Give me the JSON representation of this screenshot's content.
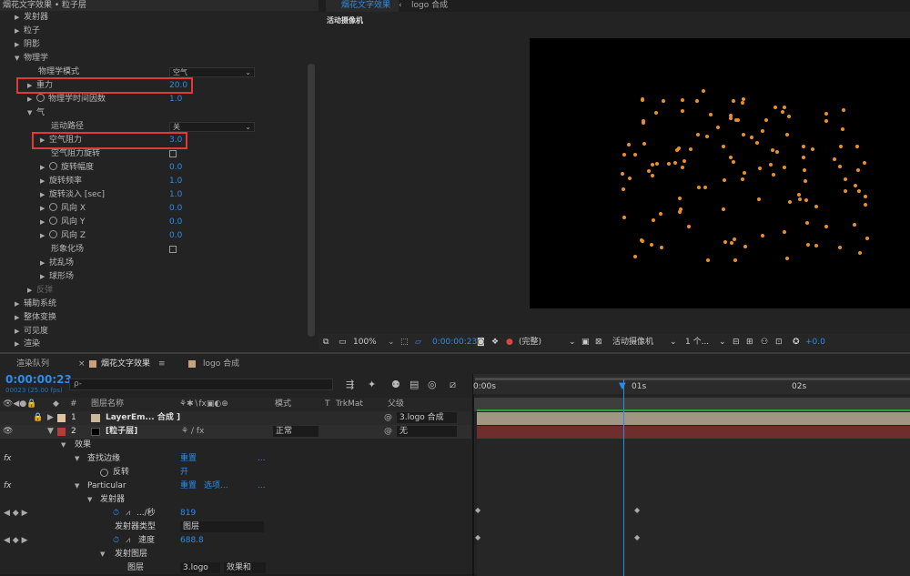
{
  "effect_panel": {
    "header": "烟花文字效果 • 粒子层",
    "rows": [
      {
        "label": "发射器",
        "value": ""
      },
      {
        "label": "粒子",
        "value": ""
      },
      {
        "label": "阴影",
        "value": ""
      },
      {
        "label": "物理学",
        "value": ""
      },
      {
        "label": "物理学模式",
        "value": "空气"
      },
      {
        "label": "重力",
        "value": "20.0"
      },
      {
        "label": "物理学时间因数",
        "value": "1.0"
      },
      {
        "label": "气",
        "value": ""
      },
      {
        "label": "运动路径",
        "value": "关"
      },
      {
        "label": "空气阻力",
        "value": "3.0"
      },
      {
        "label": "空气阻力旋转",
        "value": ""
      },
      {
        "label": "旋转幅度",
        "value": "0.0"
      },
      {
        "label": "旋转频率",
        "value": "1.0"
      },
      {
        "label": "旋转淡入 [sec]",
        "value": "1.0"
      },
      {
        "label": "风向 X",
        "value": "0.0"
      },
      {
        "label": "风向 Y",
        "value": "0.0"
      },
      {
        "label": "风向 Z",
        "value": "0.0"
      },
      {
        "label": "形象化场",
        "value": ""
      },
      {
        "label": "扰乱场",
        "value": ""
      },
      {
        "label": "球形场",
        "value": ""
      },
      {
        "label": "反弹",
        "value": ""
      },
      {
        "label": "辅助系统",
        "value": ""
      },
      {
        "label": "整体变换",
        "value": ""
      },
      {
        "label": "可见度",
        "value": ""
      },
      {
        "label": "渲染",
        "value": ""
      }
    ]
  },
  "viewer": {
    "tab_active": "烟花文字效果",
    "tab_other": "logo 合成",
    "camera_label": "活动摄像机",
    "zoom": "100%",
    "timecode": "0:00:00:23",
    "quality": "(完整)",
    "camera_dropdown": "活动摄像机",
    "views": "1 个...",
    "exposure": "+0.0"
  },
  "timeline": {
    "tab_render": "渲染队列",
    "tab_comp": "烟花文字效果",
    "tab_logo": "logo 合成",
    "timecode": "0:00:00:23",
    "fps": "00023 (25.00 fps)",
    "search_placeholder": "ρ-",
    "col_num": "#",
    "col_name": "图层名称",
    "col_mode": "模式",
    "col_t": "T",
    "col_trkmat": "TrkMat",
    "col_parent": "父级",
    "ruler": [
      "0:00s",
      "01s",
      "02s"
    ],
    "layers": [
      {
        "num": "1",
        "name": "LayerEm... 合成 ]",
        "parent": "3.logo 合成"
      },
      {
        "num": "2",
        "name": "[粒子层]",
        "mode": "正常",
        "parent": "无"
      }
    ],
    "props": {
      "effects": "效果",
      "find_edges": "查找边缘",
      "reset": "重置",
      "ellipsis": "...",
      "invert": "反转",
      "invert_val": "开",
      "particular": "Particular",
      "options": "选项...",
      "emitter": "发射器",
      "rate": ".../秒",
      "rate_val": "819",
      "emitter_type": "发射器类型",
      "emitter_type_val": "图层",
      "velocity": "速度",
      "velocity_val": "688.8",
      "emitter_layer": "发射图层",
      "layer": "图层",
      "layer_val": "3.logo",
      "layer_val2": "效果和"
    }
  }
}
